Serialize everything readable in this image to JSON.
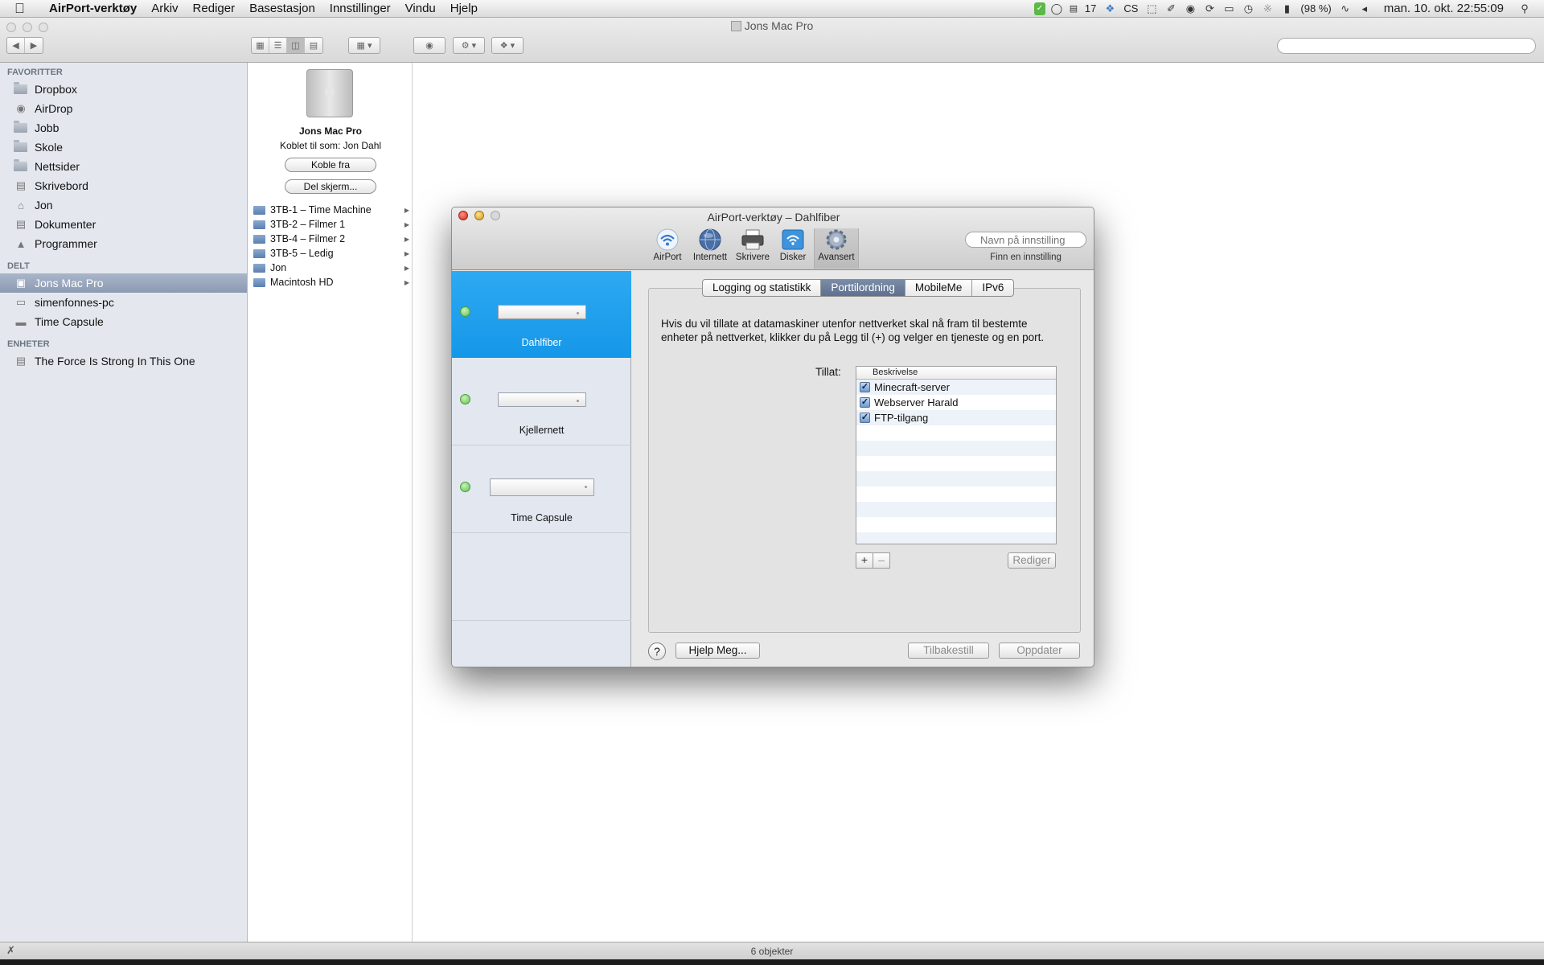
{
  "menubar": {
    "app": "AirPort-verktøy",
    "items": [
      "Arkiv",
      "Rediger",
      "Basestasjon",
      "Innstillinger",
      "Vindu",
      "Hjelp"
    ],
    "right": {
      "count": "17",
      "cs": "CS",
      "battery": "(98 %)",
      "clock": "man. 10. okt.  22:55:09"
    }
  },
  "finder": {
    "title": "Jons Mac Pro",
    "search_placeholder": "",
    "sidebar": {
      "favorites_title": "FAVORITTER",
      "favorites": [
        "Dropbox",
        "AirDrop",
        "Jobb",
        "Skole",
        "Nettsider",
        "Skrivebord",
        "Jon",
        "Dokumenter",
        "Programmer"
      ],
      "shared_title": "DELT",
      "shared": [
        "Jons Mac Pro",
        "simenfonnes-pc",
        "Time Capsule"
      ],
      "devices_title": "ENHETER",
      "devices": [
        "The Force Is Strong In This One"
      ]
    },
    "computer": {
      "name": "Jons Mac Pro",
      "connected": "Koblet til som: Jon Dahl",
      "disconnect": "Koble fra",
      "share_screen": "Del skjerm..."
    },
    "volumes": [
      "3TB-1 – Time Machine",
      "3TB-2 – Filmer 1",
      "3TB-4 – Filmer 2",
      "3TB-5 – Ledig",
      "Jon",
      "Macintosh HD"
    ],
    "status": "6 objekter"
  },
  "airport": {
    "title": "AirPort-verktøy – Dahlfiber",
    "toolbar": [
      "AirPort",
      "Internett",
      "Skrivere",
      "Disker",
      "Avansert"
    ],
    "search_placeholder": "Navn på innstilling",
    "search_caption": "Finn en innstilling",
    "devices": [
      "Dahlfiber",
      "Kjellernett",
      "Time Capsule"
    ],
    "tabs": [
      "Logging og statistikk",
      "Porttilordning",
      "MobileMe",
      "IPv6"
    ],
    "description": "Hvis du vil tillate at datamaskiner utenfor nettverket skal nå fram til bestemte enheter på nettverket, klikker du på Legg til (+) og velger en tjeneste og en port.",
    "allow_label": "Tillat:",
    "column_header": "Beskrivelse",
    "rules": [
      "Minecraft-server",
      "Webserver Harald",
      "FTP-tilgang"
    ],
    "add": "+",
    "remove": "–",
    "edit": "Rediger",
    "help_q": "?",
    "help": "Hjelp Meg...",
    "reset": "Tilbakestill",
    "update": "Oppdater"
  }
}
